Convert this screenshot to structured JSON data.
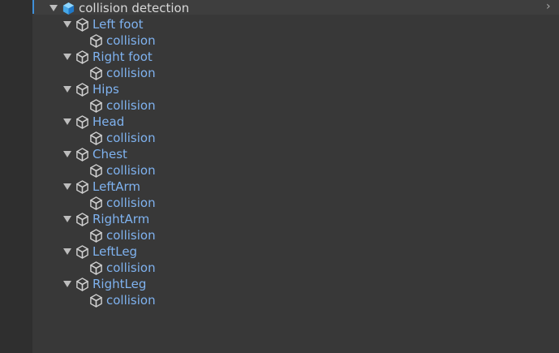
{
  "root": {
    "label": "collision detection",
    "icon": "prefab-cube-icon"
  },
  "children": [
    {
      "label": "Left foot",
      "child_label": "collision"
    },
    {
      "label": "Right foot",
      "child_label": "collision"
    },
    {
      "label": "Hips",
      "child_label": "collision"
    },
    {
      "label": "Head",
      "child_label": "collision"
    },
    {
      "label": "Chest",
      "child_label": "collision"
    },
    {
      "label": "LeftArm",
      "child_label": "collision"
    },
    {
      "label": "RightArm",
      "child_label": "collision"
    },
    {
      "label": "LeftLeg",
      "child_label": "collision"
    },
    {
      "label": "RightLeg",
      "child_label": "collision"
    }
  ],
  "colors": {
    "accent": "#3f8fd8",
    "node_text": "#7fb2ef",
    "root_text": "#d8d8d8",
    "background": "#383838"
  }
}
